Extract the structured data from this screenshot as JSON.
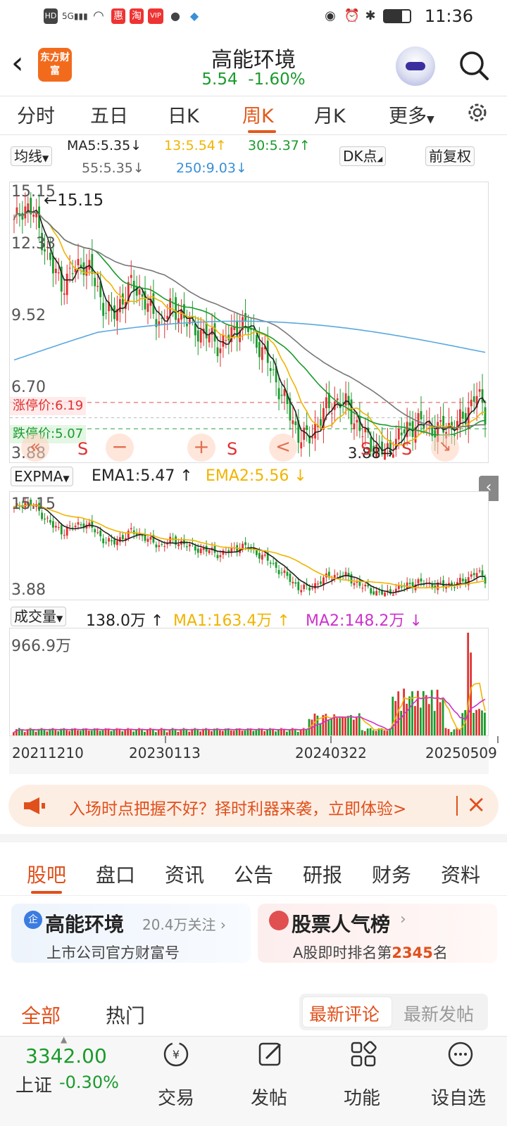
{
  "status_bar": {
    "time": "11:36",
    "left_icons": [
      "hd-icon",
      "5g-signal-icon",
      "wifi-icon",
      "app-badge-icon",
      "taobao-icon",
      "app-badge-icon",
      "wechat-icon",
      "app-icon"
    ],
    "right_icons": [
      "eye-icon",
      "alarm-icon",
      "bluetooth-icon",
      "battery-icon"
    ]
  },
  "header": {
    "title": "高能环境",
    "price": "5.54",
    "change": "-1.60%",
    "logo_text": "东方财富",
    "price_color": "#1a9b2c"
  },
  "period_tabs": [
    "分时",
    "五日",
    "日K",
    "周K",
    "月K",
    "更多"
  ],
  "active_period": "周K",
  "ma_row": {
    "selector": "均线",
    "ma5": "MA5:5.35",
    "ma5_dir": "↓",
    "ma13": "13:5.54",
    "ma13_dir": "↑",
    "ma30": "30:5.37",
    "ma30_dir": "↑",
    "ma55": "55:5.35",
    "ma55_dir": "↓",
    "ma250": "250:9.03",
    "ma250_dir": "↓",
    "dk_button": "DK点",
    "fq_button": "前复权"
  },
  "kline": {
    "y_labels": [
      "15.15",
      "12.33",
      "9.52",
      "6.70",
      "3.88"
    ],
    "max_note": "←15.15",
    "min_note": "3.88→",
    "limit_up": "涨停价:6.19",
    "limit_down": "跌停价:5.07",
    "markers": [
      "S",
      "S",
      "S",
      "S"
    ],
    "nav_icons": [
      "«",
      "−",
      "+",
      "<"
    ]
  },
  "expma": {
    "selector": "EXPMA",
    "ema1": "EMA1:5.47",
    "ema1_dir": "↑",
    "ema2": "EMA2:5.56",
    "ema2_dir": "↓",
    "top": "15.15",
    "bottom": "3.88"
  },
  "volume": {
    "selector": "成交量",
    "value": "138.0万",
    "value_dir": "↑",
    "ma1": "MA1:163.4万",
    "ma1_dir": "↑",
    "ma2": "MA2:148.2万",
    "ma2_dir": "↓",
    "top": "966.9万"
  },
  "dates": [
    "20211210",
    "20230113",
    "20240322",
    "20250509"
  ],
  "promo": {
    "text": "入场时点把握不好？择时利器来袭，立即体验>",
    "close": "×"
  },
  "section_tabs": [
    "股吧",
    "盘口",
    "资讯",
    "公告",
    "研报",
    "财务",
    "资料"
  ],
  "active_section": "股吧",
  "cards": {
    "left_title": "高能环境",
    "left_badge": "企",
    "left_follow": "20.4万关注",
    "left_sub": "上市公司官方财富号",
    "right_title": "股票人气榜",
    "right_sub_prefix": "A股即时排名第",
    "right_rank": "2345",
    "right_sub_suffix": "名"
  },
  "feed_tabs": [
    "全部",
    "热门"
  ],
  "sort_options": [
    "最新评论",
    "最新发帖"
  ],
  "bottom_bar": {
    "index_value": "3342.00",
    "index_name": "上证",
    "index_change": "-0.30%",
    "nav": [
      "交易",
      "发帖",
      "功能",
      "设自选"
    ]
  },
  "colors": {
    "accent": "#e0501c",
    "up": "#e03030",
    "down": "#1a9b2c",
    "ma13": "#f0b400",
    "ma250": "#5aa8e0",
    "ma2_volume": "#cc33cc"
  },
  "chart_data": [
    {
      "type": "candlestick",
      "title": "周K",
      "ylim": [
        3.88,
        15.15
      ],
      "yticks": [
        15.15,
        12.33,
        9.52,
        6.7,
        3.88
      ],
      "x_tick_labels": [
        "20211210",
        "20230113",
        "20240322",
        "20250509"
      ],
      "close_approx": [
        13.8,
        14.6,
        14.2,
        13.0,
        11.8,
        11.2,
        11.8,
        12.2,
        11.6,
        10.4,
        9.8,
        10.6,
        11.2,
        10.8,
        10.0,
        9.6,
        10.2,
        10.0,
        9.4,
        9.2,
        9.0,
        8.6,
        9.0,
        9.6,
        9.3,
        8.6,
        7.8,
        6.8,
        5.8,
        4.8,
        4.6,
        5.4,
        6.0,
        6.3,
        6.0,
        5.2,
        4.6,
        4.2,
        4.0,
        4.7,
        5.0,
        5.4,
        5.2,
        5.1,
        5.0,
        5.3,
        5.5,
        6.8,
        5.54
      ],
      "series": [
        {
          "name": "MA5",
          "last": 5.35
        },
        {
          "name": "MA13",
          "last": 5.54
        },
        {
          "name": "MA30",
          "last": 5.37
        },
        {
          "name": "MA55",
          "last": 5.35
        },
        {
          "name": "MA250",
          "last": 9.03
        }
      ]
    },
    {
      "type": "line",
      "title": "EXPMA",
      "series": [
        {
          "name": "EMA1",
          "last": 5.47
        },
        {
          "name": "EMA2",
          "last": 5.56
        }
      ]
    },
    {
      "type": "bar",
      "title": "成交量",
      "ylim": [
        0,
        966.9
      ],
      "series": [
        {
          "name": "成交量",
          "last": 138.0
        },
        {
          "name": "MA1",
          "last": 163.4
        },
        {
          "name": "MA2",
          "last": 148.2
        }
      ]
    }
  ]
}
